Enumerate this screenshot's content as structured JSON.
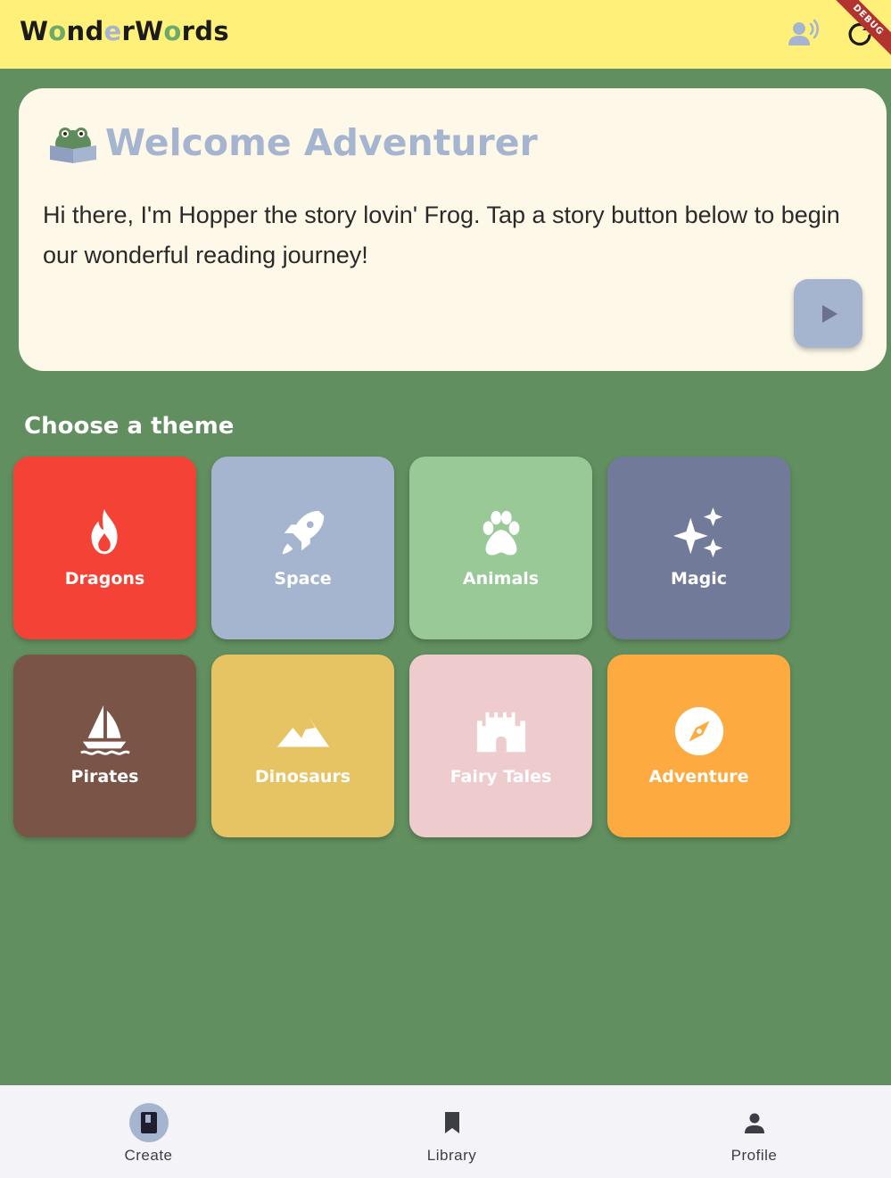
{
  "appbar": {
    "logo_letters": [
      {
        "ch": "W",
        "color": "#1b1b1b"
      },
      {
        "ch": "o",
        "color": "#6fa86b"
      },
      {
        "ch": "n",
        "color": "#1b1b1b"
      },
      {
        "ch": "d",
        "color": "#1b1b1b"
      },
      {
        "ch": "e",
        "color": "#a6b5cf"
      },
      {
        "ch": "r",
        "color": "#1b1b1b"
      },
      {
        "ch": "W",
        "color": "#1b1b1b"
      },
      {
        "ch": "o",
        "color": "#6fa86b"
      },
      {
        "ch": "r",
        "color": "#1b1b1b"
      },
      {
        "ch": "d",
        "color": "#1b1b1b"
      },
      {
        "ch": "s",
        "color": "#1b1b1b"
      }
    ],
    "voice_icon": "record-voice-icon",
    "refresh_icon": "refresh-icon",
    "debug_label": "DEBUG",
    "background": "#fff07a"
  },
  "welcome": {
    "title": "Welcome Adventurer",
    "message": "Hi there, I'm Hopper the story lovin' Frog. Tap a story button below to begin our wonderful reading journey!",
    "play_icon": "play-icon",
    "mascot_icon": "frog-reading-icon"
  },
  "themes": {
    "heading": "Choose a theme",
    "items": [
      {
        "label": "Dragons",
        "icon": "fire-icon",
        "color": "#f44336"
      },
      {
        "label": "Space",
        "icon": "rocket-icon",
        "color": "#a6b5cf"
      },
      {
        "label": "Animals",
        "icon": "paw-icon",
        "color": "#98c996"
      },
      {
        "label": "Magic",
        "icon": "sparkles-icon",
        "color": "#727a99"
      },
      {
        "label": "Pirates",
        "icon": "sailboat-icon",
        "color": "#7a5446"
      },
      {
        "label": "Dinosaurs",
        "icon": "mountains-icon",
        "color": "#e7c463"
      },
      {
        "label": "Fairy Tales",
        "icon": "castle-icon",
        "color": "#eecbcd"
      },
      {
        "label": "Adventure",
        "icon": "compass-icon",
        "color": "#fdaa41"
      }
    ]
  },
  "bottom_nav": {
    "items": [
      {
        "label": "Create",
        "icon": "book-icon",
        "selected": true
      },
      {
        "label": "Library",
        "icon": "bookmark-icon",
        "selected": false
      },
      {
        "label": "Profile",
        "icon": "person-icon",
        "selected": false
      }
    ]
  }
}
